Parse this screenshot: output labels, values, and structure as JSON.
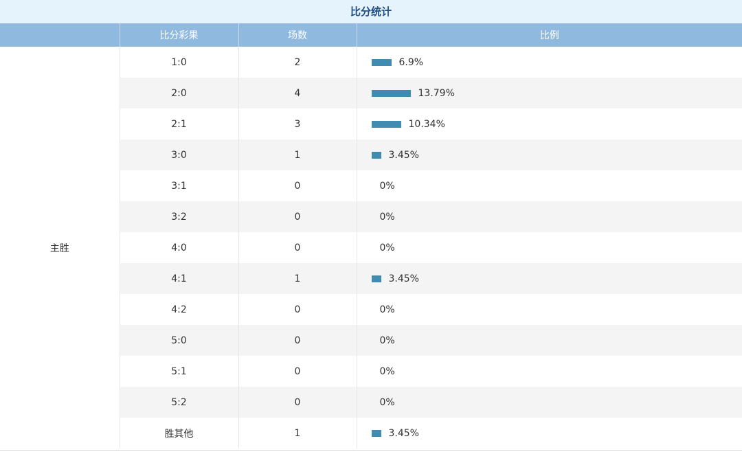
{
  "title": "比分统计",
  "headers": [
    "",
    "比分彩果",
    "场数",
    "比例"
  ],
  "category": "主胜",
  "colors": {
    "bar": "#3f8bb2",
    "header_bg": "#8fb9de",
    "title_bg": "#e5f3fc",
    "title_text": "#1e4c86"
  },
  "rows": [
    {
      "score": "1:0",
      "count": "2",
      "pct_label": "6.9%",
      "pct": 6.9
    },
    {
      "score": "2:0",
      "count": "4",
      "pct_label": "13.79%",
      "pct": 13.79
    },
    {
      "score": "2:1",
      "count": "3",
      "pct_label": "10.34%",
      "pct": 10.34
    },
    {
      "score": "3:0",
      "count": "1",
      "pct_label": "3.45%",
      "pct": 3.45
    },
    {
      "score": "3:1",
      "count": "0",
      "pct_label": "0%",
      "pct": 0
    },
    {
      "score": "3:2",
      "count": "0",
      "pct_label": "0%",
      "pct": 0
    },
    {
      "score": "4:0",
      "count": "0",
      "pct_label": "0%",
      "pct": 0
    },
    {
      "score": "4:1",
      "count": "1",
      "pct_label": "3.45%",
      "pct": 3.45
    },
    {
      "score": "4:2",
      "count": "0",
      "pct_label": "0%",
      "pct": 0
    },
    {
      "score": "5:0",
      "count": "0",
      "pct_label": "0%",
      "pct": 0
    },
    {
      "score": "5:1",
      "count": "0",
      "pct_label": "0%",
      "pct": 0
    },
    {
      "score": "5:2",
      "count": "0",
      "pct_label": "0%",
      "pct": 0
    },
    {
      "score": "胜其他",
      "count": "1",
      "pct_label": "3.45%",
      "pct": 3.45
    }
  ]
}
